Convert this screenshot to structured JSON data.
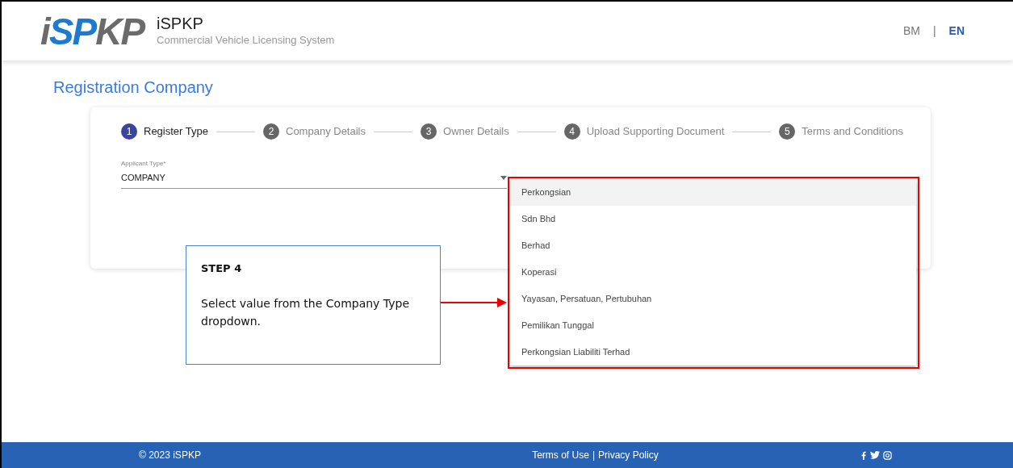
{
  "header": {
    "logo": "iSPKP",
    "title": "iSPKP",
    "subtitle": "Commercial Vehicle Licensing System",
    "languages": [
      {
        "label": "BM",
        "selected": false
      },
      {
        "label": "EN",
        "selected": true
      }
    ],
    "language_separator": "|"
  },
  "page_title": "Registration Company",
  "steps": [
    {
      "number": "1",
      "label": "Register Type",
      "selected": true
    },
    {
      "number": "2",
      "label": "Company Details",
      "selected": false
    },
    {
      "number": "3",
      "label": "Owner Details",
      "selected": false
    },
    {
      "number": "4",
      "label": "Upload Supporting Document",
      "selected": false
    },
    {
      "number": "5",
      "label": "Terms and Conditions",
      "selected": false
    }
  ],
  "applicant_type": {
    "label": "Applicant Type*",
    "value": "COMPANY"
  },
  "company_type_options": [
    {
      "label": "Perkongsian",
      "highlighted": true
    },
    {
      "label": "Sdn Bhd",
      "highlighted": false
    },
    {
      "label": "Berhad",
      "highlighted": false
    },
    {
      "label": "Koperasi",
      "highlighted": false
    },
    {
      "label": "Yayasan, Persatuan, Pertubuhan",
      "highlighted": false
    },
    {
      "label": "Pemilikan Tunggal",
      "highlighted": false
    },
    {
      "label": "Perkongsian Liabiliti Terhad",
      "highlighted": false
    }
  ],
  "callout": {
    "title": "STEP 4",
    "text": "Select value from the Company Type dropdown."
  },
  "footer": {
    "copyright": "© 2023 iSPKP",
    "links": [
      "Terms of Use",
      "Privacy Policy"
    ],
    "separator": "|"
  }
}
